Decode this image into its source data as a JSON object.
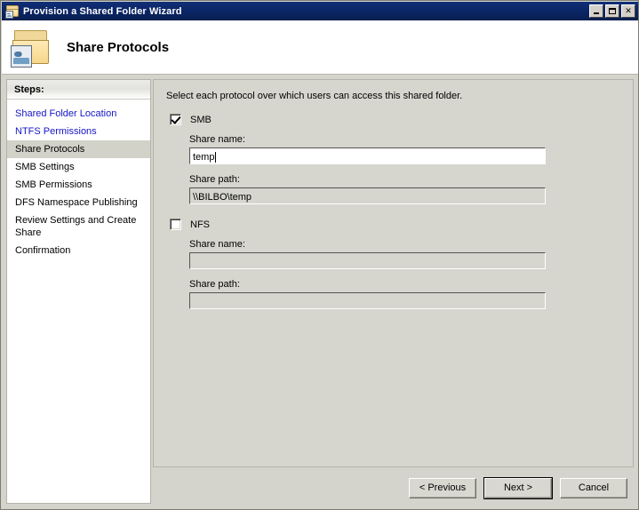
{
  "window": {
    "title": "Provision a Shared Folder Wizard",
    "icon": "shared-folder-icon",
    "minimize_label": "_",
    "maximize_label": "□",
    "close_label": "✕"
  },
  "banner": {
    "title": "Share Protocols",
    "icon": "shared-folder-icon"
  },
  "sidebar": {
    "header": "Steps:",
    "items": [
      {
        "label": "Shared Folder Location",
        "state": "completed"
      },
      {
        "label": "NTFS Permissions",
        "state": "completed"
      },
      {
        "label": "Share Protocols",
        "state": "current"
      },
      {
        "label": "SMB Settings",
        "state": "pending"
      },
      {
        "label": "SMB Permissions",
        "state": "pending"
      },
      {
        "label": "DFS Namespace Publishing",
        "state": "pending"
      },
      {
        "label": "Review Settings and Create Share",
        "state": "pending"
      },
      {
        "label": "Confirmation",
        "state": "pending"
      }
    ]
  },
  "content": {
    "intro": "Select each protocol over which users can access this shared folder.",
    "smb": {
      "label": "SMB",
      "checked": true,
      "share_name_label": "Share name:",
      "share_name_value": "temp",
      "share_path_label": "Share path:",
      "share_path_value": "\\\\BILBO\\temp"
    },
    "nfs": {
      "label": "NFS",
      "checked": false,
      "share_name_label": "Share name:",
      "share_name_value": "",
      "share_path_label": "Share path:",
      "share_path_value": ""
    }
  },
  "buttons": {
    "previous": "< Previous",
    "next": "Next >",
    "cancel": "Cancel"
  },
  "colors": {
    "titlebar": "#0a2464",
    "link": "#1515c8",
    "panel": "#d6d6ce",
    "current_step": "#d2d2c9"
  }
}
